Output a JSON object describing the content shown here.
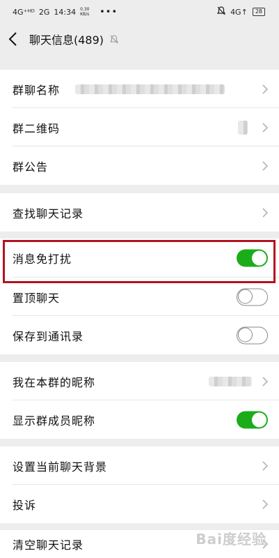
{
  "status_bar": {
    "network_left": "4G⁺ᴴᴰ",
    "network2": "2G",
    "time": "14:34",
    "speed_value": "0.30",
    "speed_unit": "KB/s",
    "network_right": "4G↑",
    "battery": "28",
    "more": "•••"
  },
  "nav": {
    "title": "聊天信息(489)"
  },
  "rows": {
    "group_name": "群聊名称",
    "qr_code": "群二维码",
    "announcement": "群公告",
    "search_history": "查找聊天记录",
    "mute_notifications": "消息免打扰",
    "sticky_on_top": "置顶聊天",
    "save_to_contacts": "保存到通讯录",
    "my_group_alias": "我在本群的昵称",
    "show_member_names": "显示群成员昵称",
    "set_background": "设置当前聊天背景",
    "report": "投诉",
    "clear_history": "清空聊天记录"
  },
  "toggles": {
    "mute_notifications": true,
    "sticky_on_top": false,
    "save_to_contacts": false,
    "show_member_names": true
  },
  "colors": {
    "toggle_on": "#1aad19",
    "highlight_border": "#b3121f"
  },
  "watermark": "Bai度经验"
}
